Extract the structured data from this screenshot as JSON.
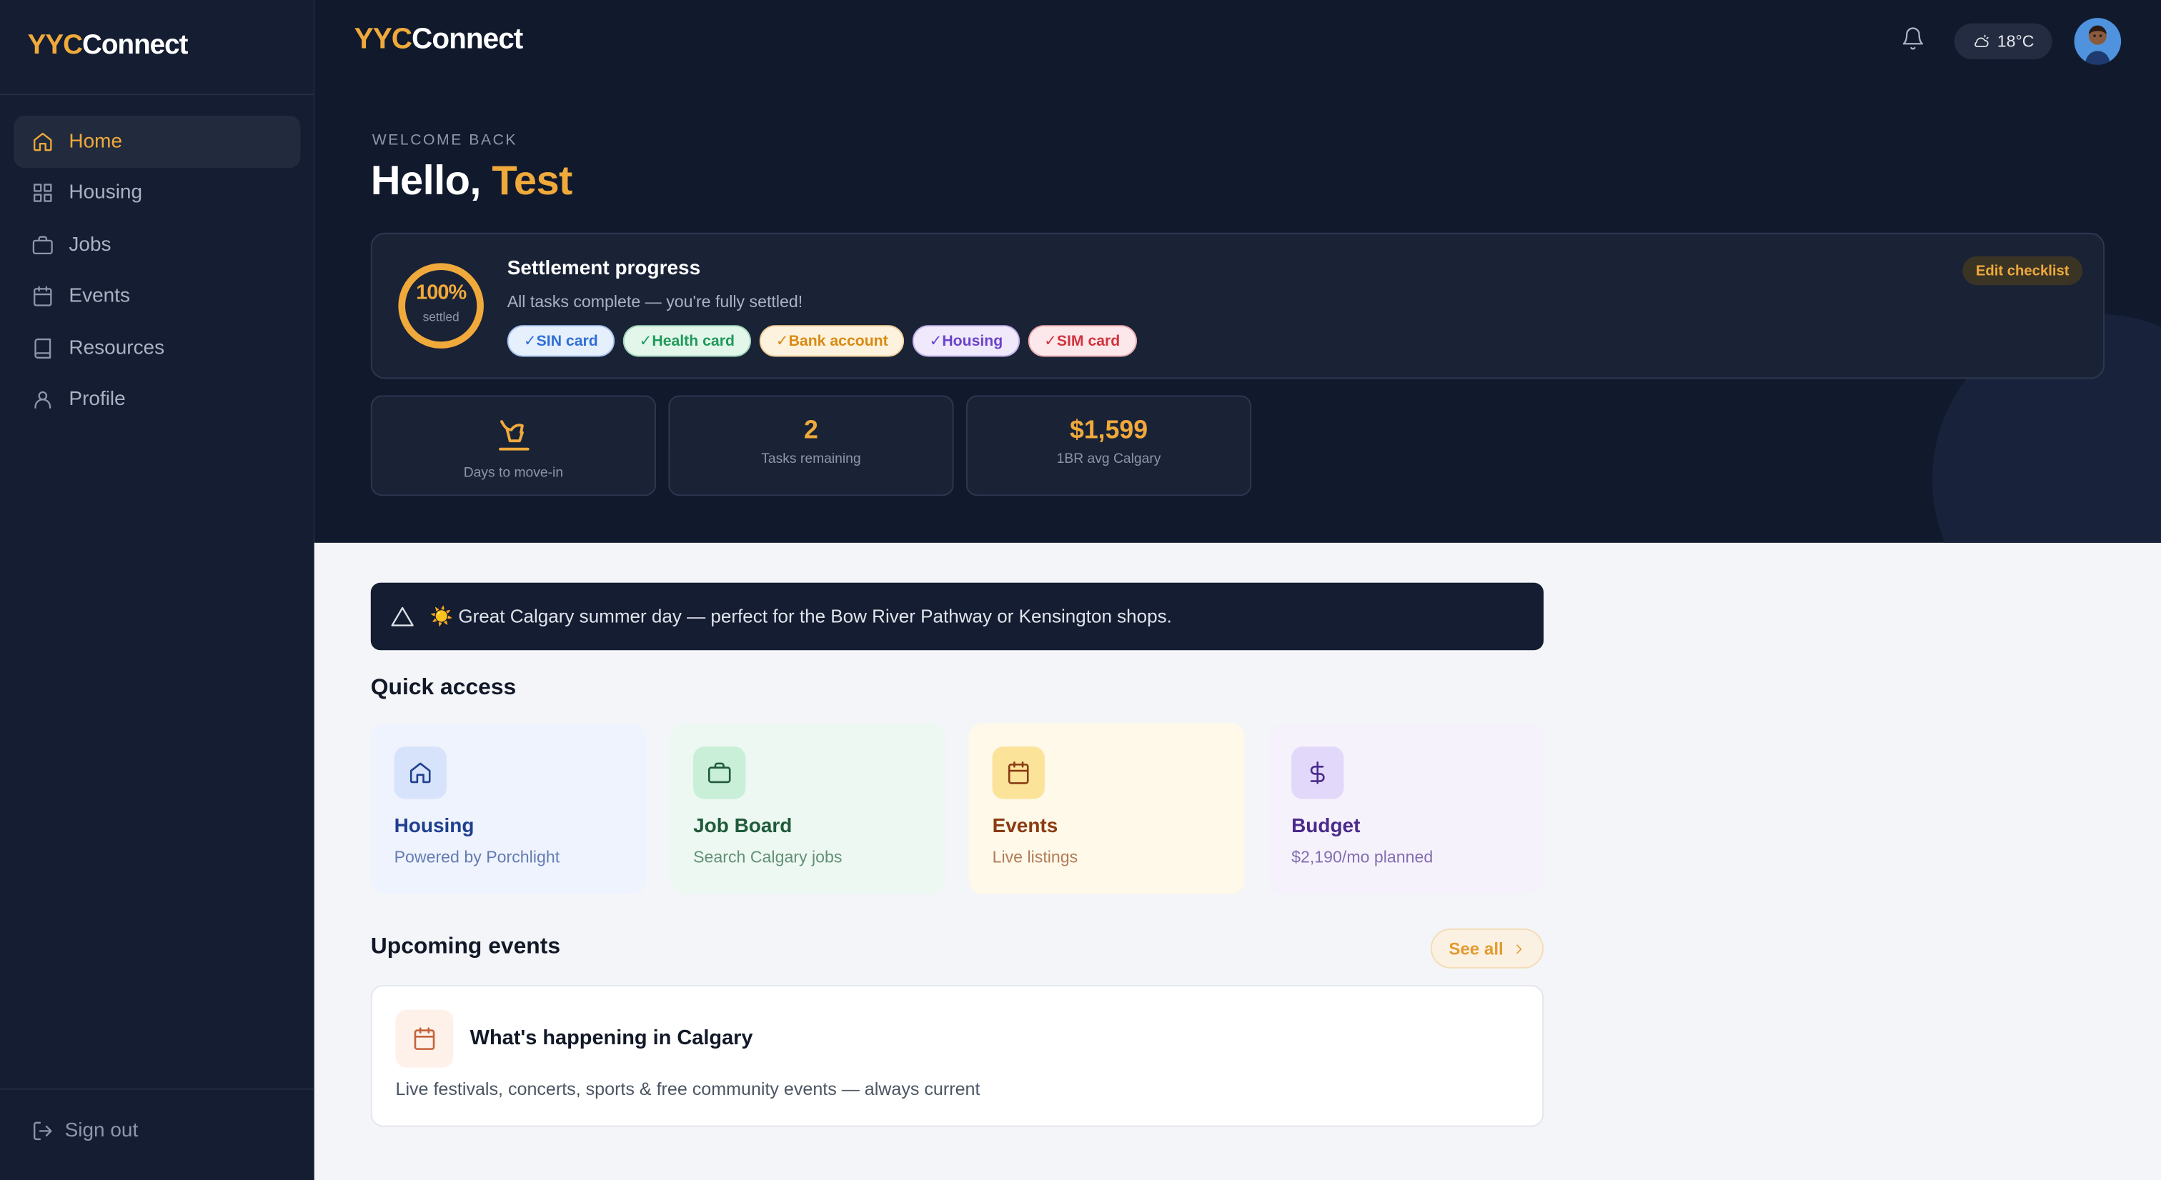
{
  "app": {
    "logo_part1": "YYC",
    "logo_part2": "Connect"
  },
  "sidebar": {
    "items": [
      {
        "label": "Home",
        "icon": "home-icon",
        "active": true
      },
      {
        "label": "Housing",
        "icon": "grid-icon"
      },
      {
        "label": "Jobs",
        "icon": "briefcase-icon"
      },
      {
        "label": "Events",
        "icon": "calendar-icon"
      },
      {
        "label": "Resources",
        "icon": "book-icon"
      },
      {
        "label": "Profile",
        "icon": "user-icon"
      }
    ],
    "sign_out": "Sign out"
  },
  "header": {
    "weather": "18°C",
    "weather_icon": "cloud-sun-icon",
    "notification_icon": "bell-icon"
  },
  "greeting": {
    "eyebrow": "WELCOME BACK",
    "hello": "Hello,",
    "name": "Test"
  },
  "settlement": {
    "percent": "100%",
    "percent_label": "settled",
    "progress_fraction": 1.0,
    "title": "Settlement progress",
    "subtitle": "All tasks complete — you're fully settled!",
    "edit_label": "Edit checklist",
    "chips": [
      {
        "label": "✓SIN card",
        "color": "#2f6fd6",
        "bg": "#e6effc"
      },
      {
        "label": "✓Health card",
        "color": "#1f9a5a",
        "bg": "#e3f6ea"
      },
      {
        "label": "✓Bank account",
        "color": "#d98a12",
        "bg": "#fdf2dd"
      },
      {
        "label": "✓Housing",
        "color": "#6a43c8",
        "bg": "#efe9fb"
      },
      {
        "label": "✓SIM card",
        "color": "#d2333f",
        "bg": "#fce8ea"
      }
    ]
  },
  "stats": [
    {
      "value": "",
      "label": "Days to move-in",
      "icon": "sign-icon"
    },
    {
      "value": "2",
      "label": "Tasks remaining"
    },
    {
      "value": "$1,599",
      "label": "1BR avg Calgary"
    }
  ],
  "banner": {
    "icon": "warning-triangle-icon",
    "text": "☀️ Great Calgary summer day — perfect for the Bow River Pathway or Kensington shops."
  },
  "quick_access": {
    "title": "Quick access",
    "cards": [
      {
        "title": "Housing",
        "subtitle": "Powered by Porchlight",
        "icon": "home-icon",
        "accent": "#1f3f8f",
        "bg": "#eef3fd"
      },
      {
        "title": "Job Board",
        "subtitle": "Search Calgary jobs",
        "icon": "briefcase-icon",
        "accent": "#1f5a3b",
        "bg": "#ecf8f1"
      },
      {
        "title": "Events",
        "subtitle": "Live listings",
        "icon": "calendar-icon",
        "accent": "#8a3b12",
        "bg": "#fef9e8"
      },
      {
        "title": "Budget",
        "subtitle": "$2,190/mo planned",
        "icon": "dollar-icon",
        "accent": "#4a2a8c",
        "bg": "#f5f2fc"
      }
    ]
  },
  "upcoming": {
    "title": "Upcoming events",
    "see_all": "See all",
    "card_title": "What's happening in Calgary",
    "card_subtitle": "Live festivals, concerts, sports & free community events — always current"
  },
  "colors": {
    "accent": "#f0a93b",
    "sidebar_bg": "#141d31",
    "hero_bg": "#111a2d"
  }
}
